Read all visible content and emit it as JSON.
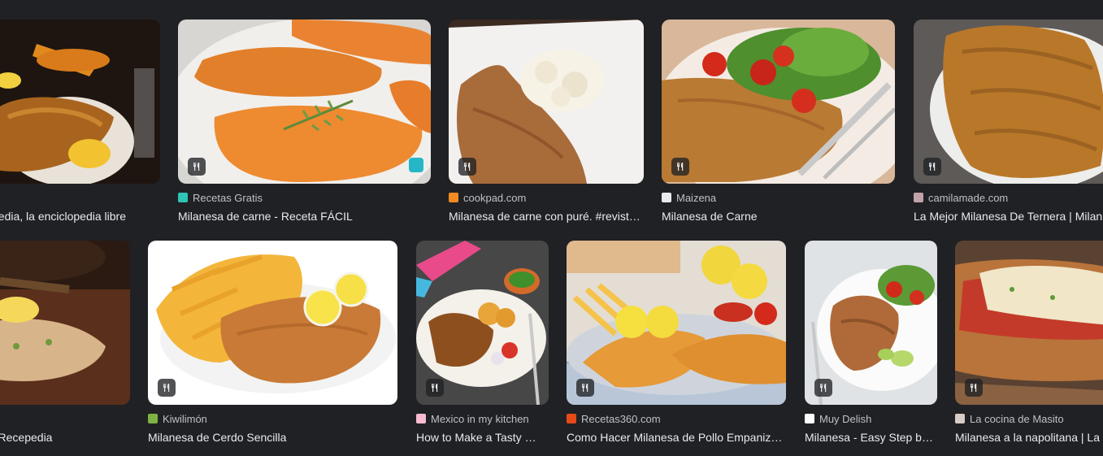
{
  "results": [
    {
      "source": "",
      "title": "pedia, la enciclopedia libre",
      "favicon_color": "#5f6368"
    },
    {
      "source": "Recetas Gratis",
      "title": "Milanesa de carne - Receta FÁCIL",
      "favicon_color": "#2ec4b6"
    },
    {
      "source": "cookpad.com",
      "title": "Milanesa de carne con puré. #revist…",
      "favicon_color": "#f28b22"
    },
    {
      "source": "Maizena",
      "title": "Milanesa de Carne",
      "favicon_color": "#e8eaed"
    },
    {
      "source": "camilamade.com",
      "title": "La Mejor Milanesa De Ternera | Milan",
      "favicon_color": "#c2a2a8"
    },
    {
      "source": "",
      "title": "| Recepedia",
      "favicon_color": "#5f6368"
    },
    {
      "source": "Kiwilimón",
      "title": "Milanesa de Cerdo Sencilla",
      "favicon_color": "#7cb342"
    },
    {
      "source": "Mexico in my kitchen",
      "title": "How to Make a Tasty …",
      "favicon_color": "#f8bbd0"
    },
    {
      "source": "Recetas360.com",
      "title": "Como Hacer Milanesa de Pollo Empaniz…",
      "favicon_color": "#e64a19"
    },
    {
      "source": "Muy Delish",
      "title": "Milanesa - Easy Step b…",
      "favicon_color": "#ffffff"
    },
    {
      "source": "La cocina de Masito",
      "title": "Milanesa a la napolitana | La",
      "favicon_color": "#d7ccc8"
    }
  ],
  "badge_icon": "fork-knife-icon"
}
